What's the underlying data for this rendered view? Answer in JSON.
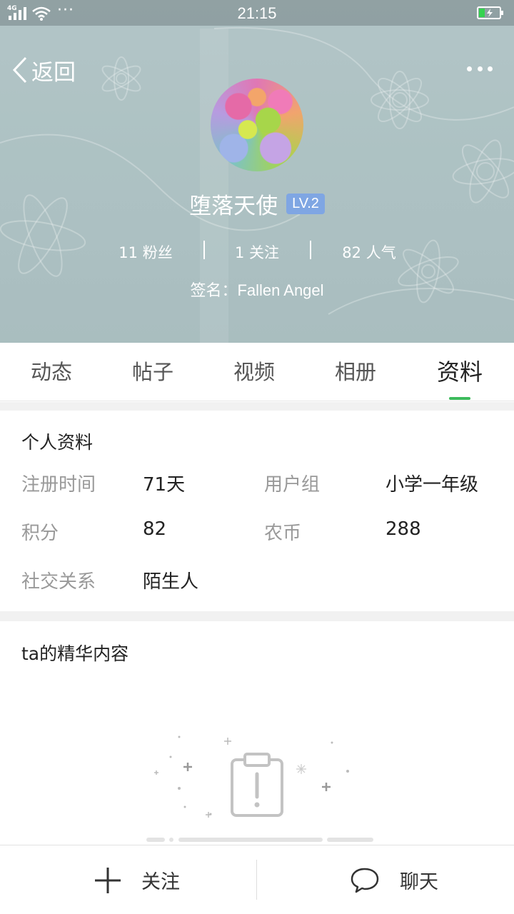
{
  "status_bar": {
    "network": "4G",
    "time": "21:15",
    "more": "···"
  },
  "header": {
    "back_label": "返回",
    "user_name": "堕落天使",
    "level": "LV.2",
    "stats": [
      {
        "value": "11",
        "label": "粉丝",
        "text": "11 粉丝"
      },
      {
        "value": "1",
        "label": "关注",
        "text": "1 关注"
      },
      {
        "value": "82",
        "label": "人气",
        "text": "82 人气"
      }
    ],
    "signature": "签名：Fallen Angel"
  },
  "tabs": [
    {
      "label": "动态",
      "active": false
    },
    {
      "label": "帖子",
      "active": false
    },
    {
      "label": "视频",
      "active": false
    },
    {
      "label": "相册",
      "active": false
    },
    {
      "label": "资料",
      "active": true
    }
  ],
  "profile": {
    "title": "个人资料",
    "fields": [
      {
        "label": "注册时间",
        "value": "71天"
      },
      {
        "label": "用户组",
        "value": "小学一年级"
      },
      {
        "label": "积分",
        "value": "82"
      },
      {
        "label": "农币",
        "value": "288"
      },
      {
        "label": "社交关系",
        "value": "陌生人"
      }
    ]
  },
  "featured": {
    "title": "ta的精华内容",
    "empty_icon": "clipboard-warning-icon"
  },
  "bottom_bar": {
    "follow": {
      "label": "关注",
      "icon": "plus-icon"
    },
    "chat": {
      "label": "聊天",
      "icon": "chat-bubble-icon"
    }
  },
  "colors": {
    "accent": "#3dbb5c",
    "level_badge": "#7fa6e3",
    "hero_bg": "#b3c7c9"
  }
}
